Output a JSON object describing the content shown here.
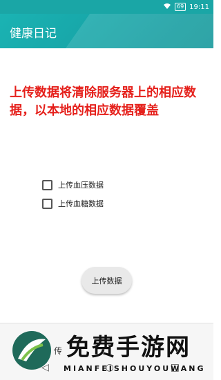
{
  "status_bar": {
    "battery": "69",
    "time": "19:11"
  },
  "app_bar": {
    "title": "健康日记"
  },
  "warning": {
    "text": "上传数据将清除服务器上的相应数据，以本地的相应数据覆盖"
  },
  "options": [
    {
      "label": "上传血压数据",
      "checked": false
    },
    {
      "label": "上传血糖数据",
      "checked": false
    }
  ],
  "upload_button": {
    "label": "上传数据"
  },
  "watermark": {
    "title": "免费手游网",
    "subtitle": "MIANFEISHOUYOUWANG",
    "partial": "传"
  },
  "colors": {
    "accent": "#1aa6a6",
    "warning": "#e5201b"
  }
}
